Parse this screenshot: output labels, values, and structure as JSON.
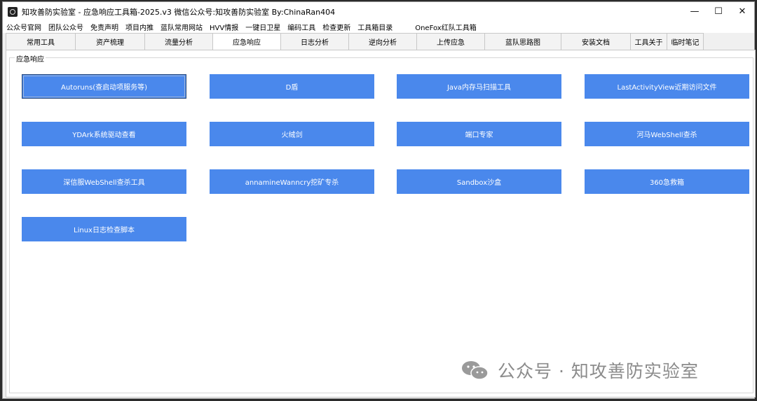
{
  "window": {
    "title": "知攻善防实验室 - 应急响应工具箱-2025.v3    微信公众号:知攻善防实验室    By:ChinaRan404",
    "controls": [
      "minimize-icon",
      "maximize-icon",
      "close-icon"
    ]
  },
  "menu": [
    "公众号官网",
    "团队公众号",
    "免责声明",
    "项目内推",
    "蓝队常用网站",
    "HVV情报",
    "一键日卫星",
    "编码工具",
    "检查更新",
    "工具箱目录",
    "OneFox红队工具箱"
  ],
  "tabs": [
    "常用工具",
    "资产梳理",
    "流量分析",
    "应急响应",
    "日志分析",
    "逆向分析",
    "上传应急",
    "蓝队思路图",
    "安装文档",
    "工具关于",
    "临时笔记"
  ],
  "active_tab": "应急响应",
  "group": {
    "label": "应急响应",
    "buttons": [
      "Autoruns(查启动项服务等)",
      "D盾",
      "Java内存马扫描工具",
      "LastActivityView近期访问文件",
      "YDArk系统驱动查看",
      "火绒剑",
      "端口专家",
      "河马WebShell查杀",
      "深信服WebShell查杀工具",
      "annamineWanncry挖矿专杀",
      "Sandbox沙盒",
      "360急救箱",
      "Linux日志检查脚本"
    ]
  },
  "watermark": "公众号 · 知攻善防实验室",
  "colors": {
    "button": "#4a88ec",
    "button_text": "#ffffff",
    "window_bg": "#f0f0f0"
  }
}
